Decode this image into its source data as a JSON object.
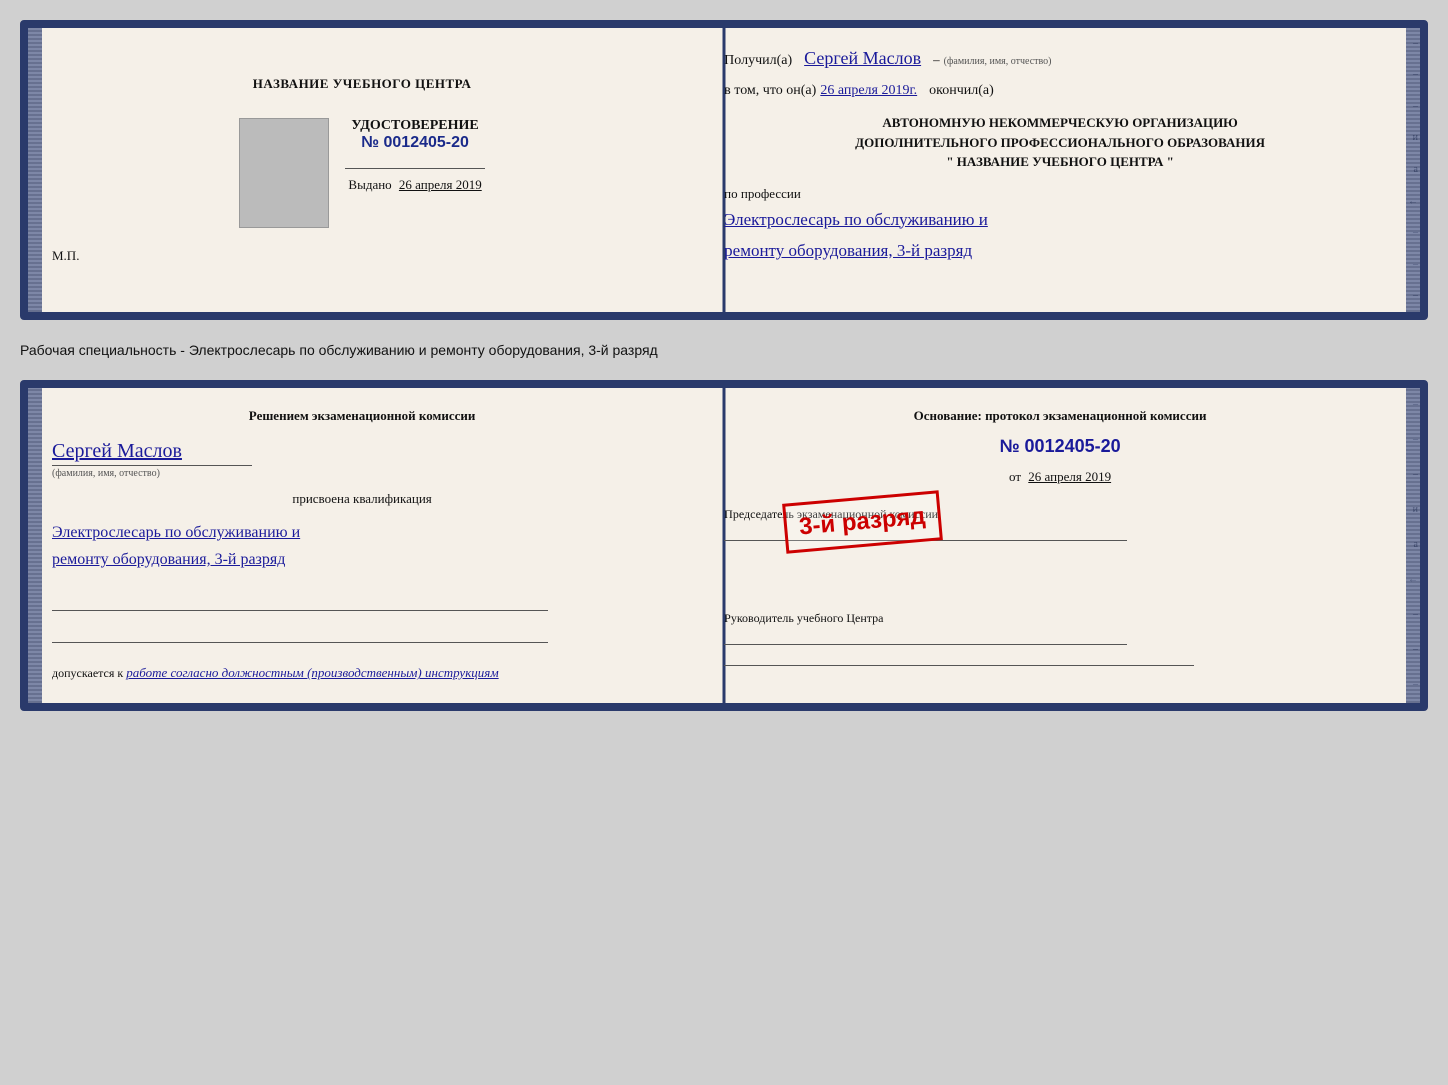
{
  "top_card": {
    "left": {
      "center_title": "НАЗВАНИЕ УЧЕБНОГО ЦЕНТРА",
      "udostoverenie_label": "УДОСТОВЕРЕНИЕ",
      "number_label": "№ 0012405-20",
      "vydano_label": "Выдано",
      "vydano_date": "26 апреля 2019",
      "mp_label": "М.П."
    },
    "right": {
      "poluchil_label": "Получил(а)",
      "poluchil_name": "Сергей Маслов",
      "fio_hint": "(фамилия, имя, отчество)",
      "vtom_label": "в том, что он(а)",
      "vtom_date": "26 апреля 2019г.",
      "okonchil_label": "окончил(а)",
      "org_line1": "АВТОНОМНУЮ НЕКОММЕРЧЕСКУЮ ОРГАНИЗАЦИЮ",
      "org_line2": "ДОПОЛНИТЕЛЬНОГО ПРОФЕССИОНАЛЬНОГО ОБРАЗОВАНИЯ",
      "org_line3": "\"   НАЗВАНИЕ УЧЕБНОГО ЦЕНТРА   \"",
      "po_professii_label": "по профессии",
      "professiya_line1": "Электрослесарь по обслуживанию и",
      "professiya_line2": "ремонту оборудования, 3-й разряд"
    }
  },
  "description": "Рабочая специальность - Электрослесарь по обслуживанию и ремонту оборудования, 3-й разряд",
  "bottom_card": {
    "left": {
      "resheniem_title": "Решением экзаменационной комиссии",
      "person_name": "Сергей Маслов",
      "fio_hint": "(фамилия, имя, отчество)",
      "prisvoena_label": "присвоена квалификация",
      "kval_line1": "Электрослесарь по обслуживанию и",
      "kval_line2": "ремонту оборудования, 3-й разряд",
      "dopuskaetsya_label": "допускается к",
      "dopuskaetsya_text": "работе согласно должностным (производственным) инструкциям"
    },
    "right": {
      "osnovanie_label": "Основание: протокол экзаменационной комиссии",
      "protocol_number": "№  0012405-20",
      "ot_label": "от",
      "ot_date": "26 апреля 2019",
      "predsedatel_label": "Председатель экзаменационной комиссии",
      "stamp_text": "3-й разряд",
      "rukovoditel_label": "Руководитель учебного Центра",
      "right_dashes": [
        "-",
        "-",
        "-",
        "и",
        "а",
        "←",
        "-",
        "-",
        "-"
      ]
    }
  },
  "left_side_dashes": [
    "-",
    "-",
    "-",
    "-",
    "-",
    "-",
    "-",
    "-"
  ],
  "right_side_dashes": [
    "-",
    "-",
    "-",
    "и",
    "а",
    "←",
    "-",
    "-",
    "-"
  ]
}
